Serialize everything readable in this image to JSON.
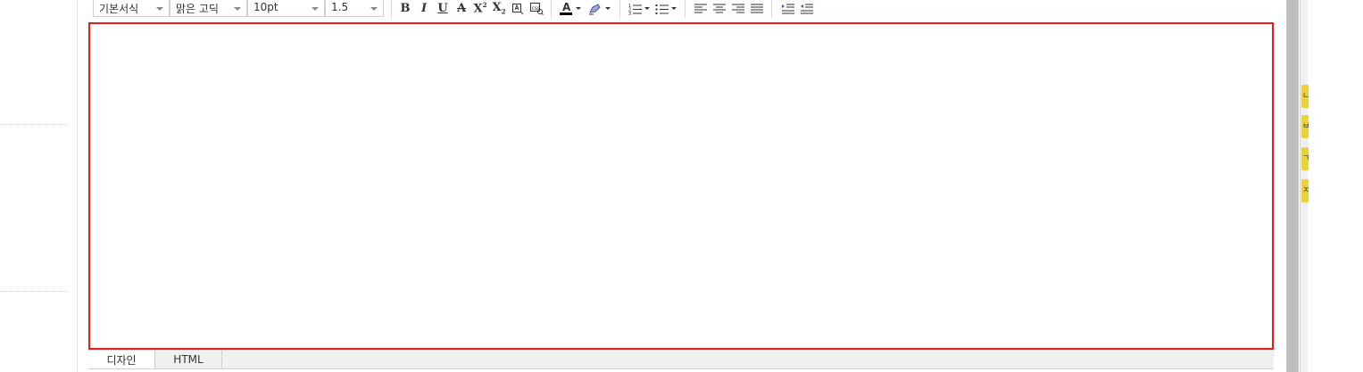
{
  "toolbar": {
    "format_select": "기본서식",
    "font_select": "맑은 고딕",
    "size_select": "10pt",
    "line_height_select": "1.5",
    "buttons": {
      "bold": "B",
      "italic": "I",
      "underline": "U",
      "strikethrough": "A",
      "superscript": "X",
      "superscript_mark": "2",
      "subscript": "X",
      "subscript_mark": "2",
      "font_color": "A"
    }
  },
  "tabs": {
    "design": "디자인",
    "html": "HTML"
  },
  "side_tabs": [
    "ㄴ",
    "ㅂ",
    "ㄱ",
    "ㅈ"
  ],
  "colors": {
    "edit_border": "#e02020",
    "font_color_bar": "#000000",
    "side_tab": "#e9d23a"
  }
}
